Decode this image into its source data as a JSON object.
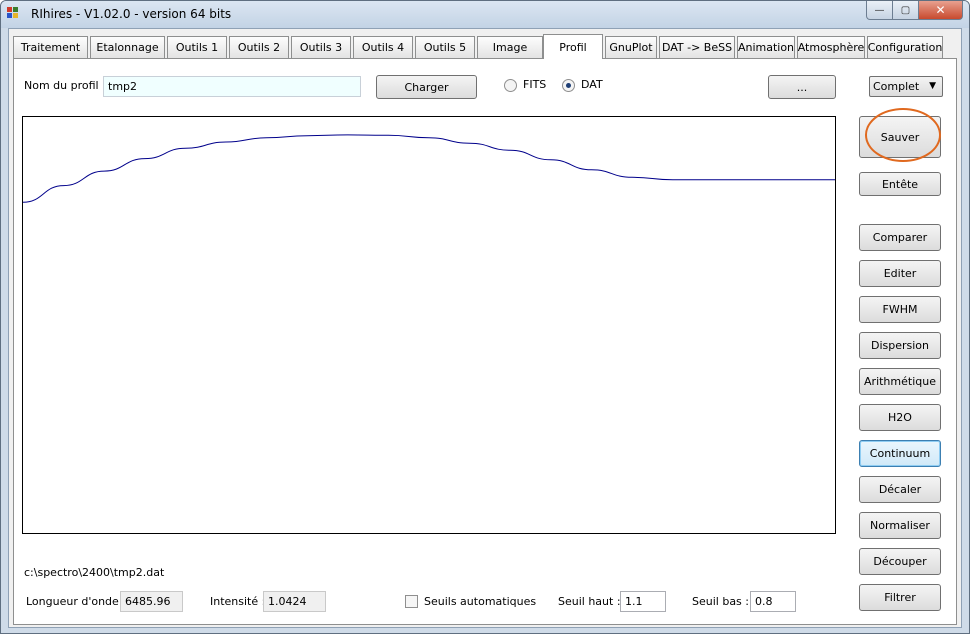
{
  "window": {
    "title": "RIhires - V1.02.0 - version 64 bits",
    "buttons": {
      "minimize": "—",
      "maximize": "▢",
      "close": "✕"
    }
  },
  "tabs": [
    "Traitement",
    "Etalonnage",
    "Outils 1",
    "Outils 2",
    "Outils 3",
    "Outils 4",
    "Outils 5",
    "Image",
    "Profil",
    "GnuPlot",
    "DAT -> BeSS",
    "Animation",
    "Atmosphère",
    "Configuration"
  ],
  "active_tab": "Profil",
  "profile": {
    "name_label": "Nom du profil :",
    "name_value": "tmp2",
    "load_button": "Charger",
    "format_options": [
      {
        "label": "FITS",
        "checked": false
      },
      {
        "label": "DAT",
        "checked": true
      }
    ],
    "browse_button": "...",
    "mode_select": "Complet"
  },
  "side_buttons": [
    "Sauver",
    "Entête",
    "Comparer",
    "Editer",
    "FWHM",
    "Dispersion",
    "Arithmétique",
    "H2O",
    "Continuum",
    "Décaler",
    "Normaliser",
    "Découper",
    "Filtrer"
  ],
  "focused_button": "Continuum",
  "status": {
    "file_path": "c:\\spectro\\2400\\tmp2.dat",
    "wavelength_label": "Longueur d'onde :",
    "wavelength_value": "6485.96",
    "intensity_label": "Intensité :",
    "intensity_value": "1.0424",
    "auto_threshold_label": "Seuils automatiques",
    "auto_threshold_checked": false,
    "high_threshold_label": "Seuil haut :",
    "high_threshold_value": "1.1",
    "low_threshold_label": "Seuil bas :",
    "low_threshold_value": "0.8"
  },
  "colors": {
    "curve": "#00008b",
    "highlight": "#e0691f"
  },
  "icons": {
    "app": "app-color-squares-icon",
    "radio": "radio-icon",
    "checkbox": "checkbox-icon",
    "dropdown": "chevron-down-icon"
  },
  "profile_curve": {
    "y_range": [
      0,
      1
    ],
    "points": [
      [
        0.0,
        0.795
      ],
      [
        0.05,
        0.835
      ],
      [
        0.1,
        0.87
      ],
      [
        0.15,
        0.9
      ],
      [
        0.2,
        0.925
      ],
      [
        0.25,
        0.94
      ],
      [
        0.3,
        0.95
      ],
      [
        0.35,
        0.955
      ],
      [
        0.4,
        0.957
      ],
      [
        0.45,
        0.956
      ],
      [
        0.5,
        0.95
      ],
      [
        0.55,
        0.937
      ],
      [
        0.6,
        0.92
      ],
      [
        0.65,
        0.897
      ],
      [
        0.7,
        0.873
      ],
      [
        0.75,
        0.855
      ],
      [
        0.8,
        0.849
      ],
      [
        0.85,
        0.849
      ],
      [
        0.9,
        0.849
      ],
      [
        0.95,
        0.849
      ],
      [
        1.0,
        0.849
      ]
    ]
  }
}
